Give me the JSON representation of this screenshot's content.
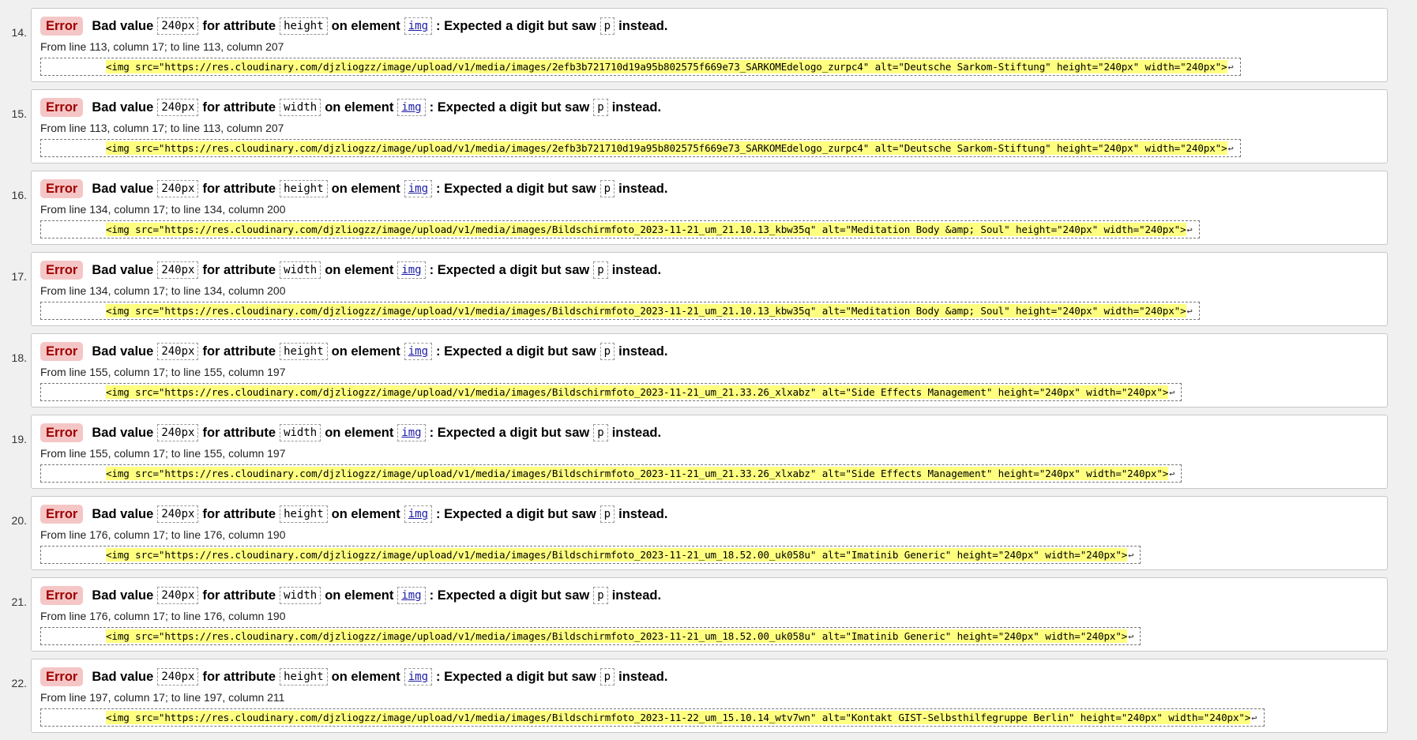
{
  "messages": [
    {
      "number": "14.",
      "type": "Error",
      "msg_before": "Bad value",
      "value": "240px",
      "msg_attr": "for attribute",
      "attribute": "height",
      "msg_on": "on element",
      "element": "img",
      "msg_after": ": Expected a digit but saw",
      "char": "p",
      "msg_end": "instead.",
      "location": "From line 113, column 17; to line 113, column 207",
      "extract": "<img src=\"https://res.cloudinary.com/djzliogzz/image/upload/v1/media/images/2efb3b721710d19a95b802575f669e73_SARKOMEdelogo_zurpc4\" alt=\"Deutsche Sarkom-Stiftung\" height=\"240px\" width=\"240px\">",
      "return_glyph": "↩"
    },
    {
      "number": "15.",
      "type": "Error",
      "msg_before": "Bad value",
      "value": "240px",
      "msg_attr": "for attribute",
      "attribute": "width",
      "msg_on": "on element",
      "element": "img",
      "msg_after": ": Expected a digit but saw",
      "char": "p",
      "msg_end": "instead.",
      "location": "From line 113, column 17; to line 113, column 207",
      "extract": "<img src=\"https://res.cloudinary.com/djzliogzz/image/upload/v1/media/images/2efb3b721710d19a95b802575f669e73_SARKOMEdelogo_zurpc4\" alt=\"Deutsche Sarkom-Stiftung\" height=\"240px\" width=\"240px\">",
      "return_glyph": "↩"
    },
    {
      "number": "16.",
      "type": "Error",
      "msg_before": "Bad value",
      "value": "240px",
      "msg_attr": "for attribute",
      "attribute": "height",
      "msg_on": "on element",
      "element": "img",
      "msg_after": ": Expected a digit but saw",
      "char": "p",
      "msg_end": "instead.",
      "location": "From line 134, column 17; to line 134, column 200",
      "extract": "<img src=\"https://res.cloudinary.com/djzliogzz/image/upload/v1/media/images/Bildschirmfoto_2023-11-21_um_21.10.13_kbw35q\" alt=\"Meditation Body &amp; Soul\" height=\"240px\" width=\"240px\">",
      "return_glyph": "↩"
    },
    {
      "number": "17.",
      "type": "Error",
      "msg_before": "Bad value",
      "value": "240px",
      "msg_attr": "for attribute",
      "attribute": "width",
      "msg_on": "on element",
      "element": "img",
      "msg_after": ": Expected a digit but saw",
      "char": "p",
      "msg_end": "instead.",
      "location": "From line 134, column 17; to line 134, column 200",
      "extract": "<img src=\"https://res.cloudinary.com/djzliogzz/image/upload/v1/media/images/Bildschirmfoto_2023-11-21_um_21.10.13_kbw35q\" alt=\"Meditation Body &amp; Soul\" height=\"240px\" width=\"240px\">",
      "return_glyph": "↩"
    },
    {
      "number": "18.",
      "type": "Error",
      "msg_before": "Bad value",
      "value": "240px",
      "msg_attr": "for attribute",
      "attribute": "height",
      "msg_on": "on element",
      "element": "img",
      "msg_after": ": Expected a digit but saw",
      "char": "p",
      "msg_end": "instead.",
      "location": "From line 155, column 17; to line 155, column 197",
      "extract": "<img src=\"https://res.cloudinary.com/djzliogzz/image/upload/v1/media/images/Bildschirmfoto_2023-11-21_um_21.33.26_xlxabz\" alt=\"Side Effects Management\" height=\"240px\" width=\"240px\">",
      "return_glyph": "↩"
    },
    {
      "number": "19.",
      "type": "Error",
      "msg_before": "Bad value",
      "value": "240px",
      "msg_attr": "for attribute",
      "attribute": "width",
      "msg_on": "on element",
      "element": "img",
      "msg_after": ": Expected a digit but saw",
      "char": "p",
      "msg_end": "instead.",
      "location": "From line 155, column 17; to line 155, column 197",
      "extract": "<img src=\"https://res.cloudinary.com/djzliogzz/image/upload/v1/media/images/Bildschirmfoto_2023-11-21_um_21.33.26_xlxabz\" alt=\"Side Effects Management\" height=\"240px\" width=\"240px\">",
      "return_glyph": "↩"
    },
    {
      "number": "20.",
      "type": "Error",
      "msg_before": "Bad value",
      "value": "240px",
      "msg_attr": "for attribute",
      "attribute": "height",
      "msg_on": "on element",
      "element": "img",
      "msg_after": ": Expected a digit but saw",
      "char": "p",
      "msg_end": "instead.",
      "location": "From line 176, column 17; to line 176, column 190",
      "extract": "<img src=\"https://res.cloudinary.com/djzliogzz/image/upload/v1/media/images/Bildschirmfoto_2023-11-21_um_18.52.00_uk058u\" alt=\"Imatinib Generic\" height=\"240px\" width=\"240px\">",
      "return_glyph": "↩"
    },
    {
      "number": "21.",
      "type": "Error",
      "msg_before": "Bad value",
      "value": "240px",
      "msg_attr": "for attribute",
      "attribute": "width",
      "msg_on": "on element",
      "element": "img",
      "msg_after": ": Expected a digit but saw",
      "char": "p",
      "msg_end": "instead.",
      "location": "From line 176, column 17; to line 176, column 190",
      "extract": "<img src=\"https://res.cloudinary.com/djzliogzz/image/upload/v1/media/images/Bildschirmfoto_2023-11-21_um_18.52.00_uk058u\" alt=\"Imatinib Generic\" height=\"240px\" width=\"240px\">",
      "return_glyph": "↩"
    },
    {
      "number": "22.",
      "type": "Error",
      "msg_before": "Bad value",
      "value": "240px",
      "msg_attr": "for attribute",
      "attribute": "height",
      "msg_on": "on element",
      "element": "img",
      "msg_after": ": Expected a digit but saw",
      "char": "p",
      "msg_end": "instead.",
      "location": "From line 197, column 17; to line 197, column 211",
      "extract": "<img src=\"https://res.cloudinary.com/djzliogzz/image/upload/v1/media/images/Bildschirmfoto_2023-11-22_um_15.10.14_wtv7wn\" alt=\"Kontakt GIST-Selbsthilfegruppe Berlin\" height=\"240px\" width=\"240px\">",
      "return_glyph": "↩"
    }
  ],
  "colors": {
    "error_badge_bg": "#f5c6c6",
    "error_badge_text": "#a00000",
    "extract_highlight": "#ffff80",
    "link": "#1a1aa6"
  },
  "icons": {
    "return": "return-icon"
  }
}
